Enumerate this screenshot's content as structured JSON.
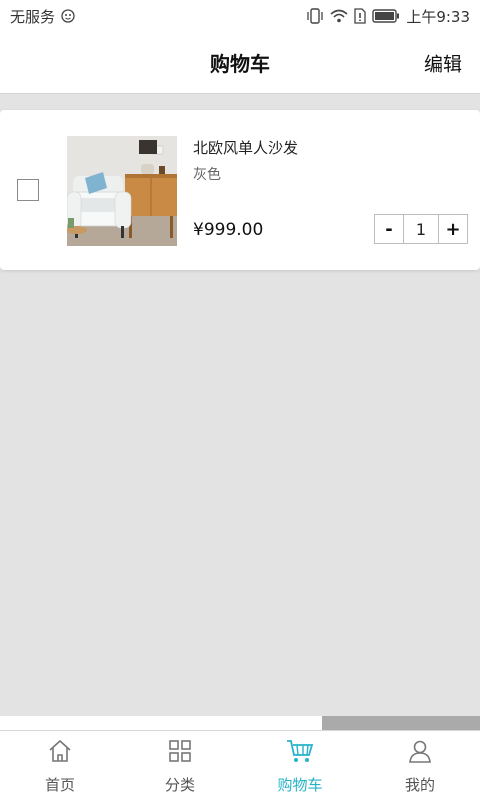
{
  "status_bar": {
    "carrier": "无服务",
    "time": "上午9:33"
  },
  "header": {
    "title": "购物车",
    "edit_label": "编辑"
  },
  "cart": {
    "items": [
      {
        "name": "北欧风单人沙发",
        "variant": "灰色",
        "price": "¥999.00",
        "quantity": "1",
        "decrease_label": "-",
        "increase_label": "+",
        "checked": false
      }
    ]
  },
  "tabbar": {
    "tabs": [
      {
        "label": "首页",
        "icon": "home-icon",
        "active": false
      },
      {
        "label": "分类",
        "icon": "grid-icon",
        "active": false
      },
      {
        "label": "购物车",
        "icon": "cart-icon",
        "active": true
      },
      {
        "label": "我的",
        "icon": "user-icon",
        "active": false
      }
    ]
  },
  "colors": {
    "accent": "#26b3c7",
    "background": "#e3e3e3"
  }
}
